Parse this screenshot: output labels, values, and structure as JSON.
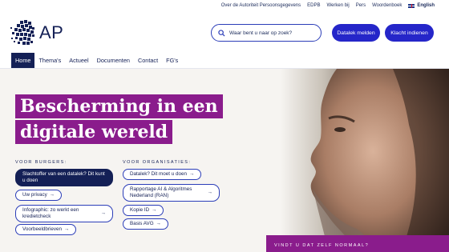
{
  "utility": {
    "links": [
      "Over de Autoriteit Persoonsgegevens",
      "EDPB",
      "Werken bij",
      "Pers",
      "Woordenboek"
    ],
    "language": "English"
  },
  "header": {
    "logo_text": "AP",
    "search_placeholder": "Waar bent u naar op zoek?",
    "datalek_label": "Datalek melden",
    "klacht_label": "Klacht indienen"
  },
  "nav": {
    "items": [
      "Home",
      "Thema's",
      "Actueel",
      "Documenten",
      "Contact",
      "FG's"
    ],
    "active": "Home"
  },
  "hero": {
    "headline_line1": "Bescherming in een",
    "headline_line2": "digitale wereld",
    "burgers_label": "VOOR BURGERS:",
    "burgers_links": [
      "Slachtoffer van een datalek? Dit kunt u doen",
      "Uw privacy",
      "Infographic: zo werkt een kredietcheck",
      "Voorbeeldbrieven"
    ],
    "org_label": "VOOR ORGANISATIES:",
    "org_links": [
      "Datalek? Dit moet u doen",
      "Rapportage AI & Algoritmes Nederland (RAN)",
      "Kopie ID",
      "Basis AVG"
    ],
    "promo_text": "VINDT U DAT ZELF NORMAAL?"
  },
  "colors": {
    "brand_navy": "#142056",
    "button_blue": "#2526c9",
    "accent_purple": "#8a1c8c"
  },
  "arrow_glyph": "→"
}
